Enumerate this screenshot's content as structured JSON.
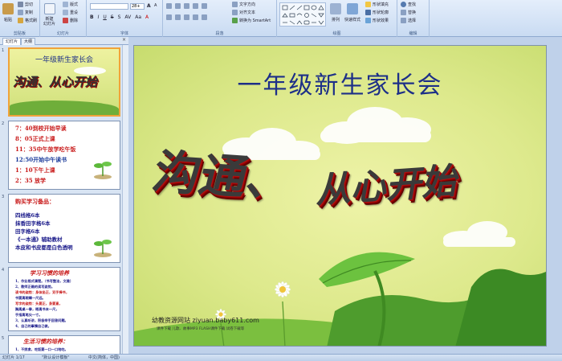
{
  "ribbon": {
    "clipboard": {
      "paste": "粘贴",
      "cut": "剪切",
      "copy": "复制",
      "format_painter": "格式刷",
      "label": "剪贴板"
    },
    "slides": {
      "new_slide": "新建\n幻灯片",
      "layout": "版式",
      "reset": "重设",
      "delete": "删除",
      "label": "幻灯片"
    },
    "font": {
      "size_value": "28+",
      "label": "字体"
    },
    "paragraph": {
      "text_direction": "文字方向",
      "align_text": "对齐文本",
      "smartart": "转换为 SmartArt",
      "label": "段落"
    },
    "drawing": {
      "arrange": "排列",
      "quick_styles": "快速样式",
      "fill": "形状填充",
      "outline": "形状轮廓",
      "effects": "形状效果",
      "label": "绘图"
    },
    "editing": {
      "find": "查找",
      "replace": "替换",
      "select": "选择",
      "label": "编辑"
    }
  },
  "pane_tabs": {
    "slides": "幻灯片",
    "outline": "大纲",
    "close": "×"
  },
  "thumbnails": [
    {
      "num": "1",
      "title": "一年级新生家长会",
      "wordart": "沟通、从心开始"
    },
    {
      "num": "2",
      "lines": [
        "7：40到校开始早读",
        "8：05正式上课",
        "11：35中午放学吃午饭",
        "12:50开始中午读书",
        "1：10下午上课",
        "2：35 放学"
      ]
    },
    {
      "num": "3",
      "heading": "购买学习备品：",
      "lines": [
        "四线格6本",
        "抹香田字格6本",
        "田字格6本",
        "《一本通》辅助教材",
        "本皮和书皮都是白色透明"
      ]
    },
    {
      "num": "4",
      "heading": "学习习惯的培养",
      "lines": [
        "1、作业格式清楚。（书写整洁，文雅）",
        "2、教师正确的读写姿势。",
        "读书的姿势：身体坐正，双手捧书，",
        "书要离眼睛一尺远。",
        "写字的姿势：头要正，身要直，",
        "胸离桌一拳，眼离书本一尺，",
        "手指离笔尖一寸。",
        "3、认真听讲，积极举手回答问题。",
        "4、自己的事情自己做。"
      ]
    },
    {
      "num": "5",
      "heading": "生活习惯的培养：",
      "lines": [
        "1、不挑食，吃饭要一口一口地吃。"
      ]
    }
  ],
  "slide": {
    "title": "一年级新生家长会",
    "wordart_part1": "沟通、",
    "wordart_part2": "从心开始",
    "footer_site": "幼教资源网站  ziyuan.baby611.com",
    "footer_links": "课件下载    儿歌、故事MP3    FLASH课件下载    试卷下载等"
  },
  "status": {
    "slide_info": "幻灯片 1/17",
    "theme": "\"默认设计模板\"",
    "language": "中文(简体，中国)"
  },
  "colors": {
    "title_blue": "#1d2f88",
    "thumb_red": "#cc1a1a",
    "slide_bg": "#dde98c",
    "ribbon_bg": "#dbe7f7"
  }
}
